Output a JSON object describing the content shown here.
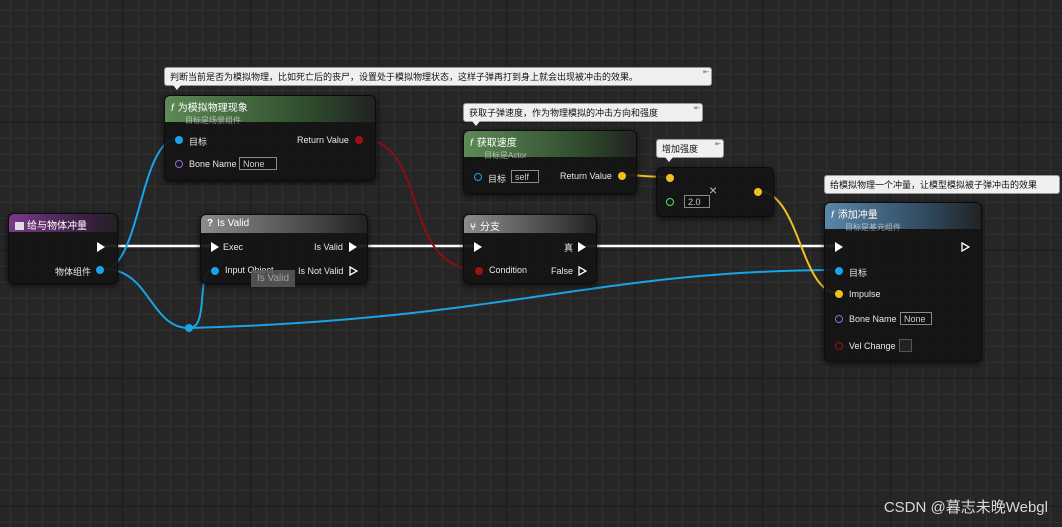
{
  "comments": {
    "physics": "判断当前是否为模拟物理，比如死亡后的丧尸，设置处于模拟物理状态，这样子弹再打到身上就会出现被冲击的效果。",
    "velocity": "获取子弹速度，作为物理模拟的冲击方向和强度",
    "strength": "增加强度",
    "impulse": "给模拟物理一个冲量，让模型模拟被子弹冲击的效果"
  },
  "nodes": {
    "event": {
      "title": "给与物体冲量",
      "pin_component": "物体组件"
    },
    "simulating": {
      "title": "为模拟物理现象",
      "subtitle": "目标是场景组件",
      "pin_target": "目标",
      "pin_bone": "Bone Name",
      "bone_value": "None",
      "pin_return": "Return Value"
    },
    "is_valid": {
      "title": "Is Valid",
      "pin_exec": "Exec",
      "pin_input": "Input Object",
      "out_valid": "Is Valid",
      "out_not_valid": "Is Not Valid"
    },
    "velocity": {
      "title": "获取速度",
      "subtitle": "目标是Actor",
      "pin_target": "目标",
      "target_value": "self",
      "pin_return": "Return Value"
    },
    "branch": {
      "title": "分支",
      "pin_condition": "Condition",
      "out_true": "真",
      "out_false": "False"
    },
    "multiply": {
      "value": "2.0",
      "op": "×"
    },
    "add_impulse": {
      "title": "添加冲量",
      "subtitle": "目标是基元组件",
      "pin_target": "目标",
      "pin_impulse": "Impulse",
      "pin_bone": "Bone Name",
      "bone_value": "None",
      "pin_vel": "Vel Change"
    }
  },
  "tooltip": "Is Valid",
  "watermark": "CSDN @暮志未晚Webgl",
  "icons": {
    "function": "function-icon",
    "event": "event-icon",
    "question": "question-icon",
    "branch": "branch-icon"
  },
  "colors": {
    "exec": "#ffffff",
    "object": "#1aa3e8",
    "bool": "#a01010",
    "vector": "#f0c020",
    "float": "#5ae05a",
    "name": "#9a6adf"
  }
}
